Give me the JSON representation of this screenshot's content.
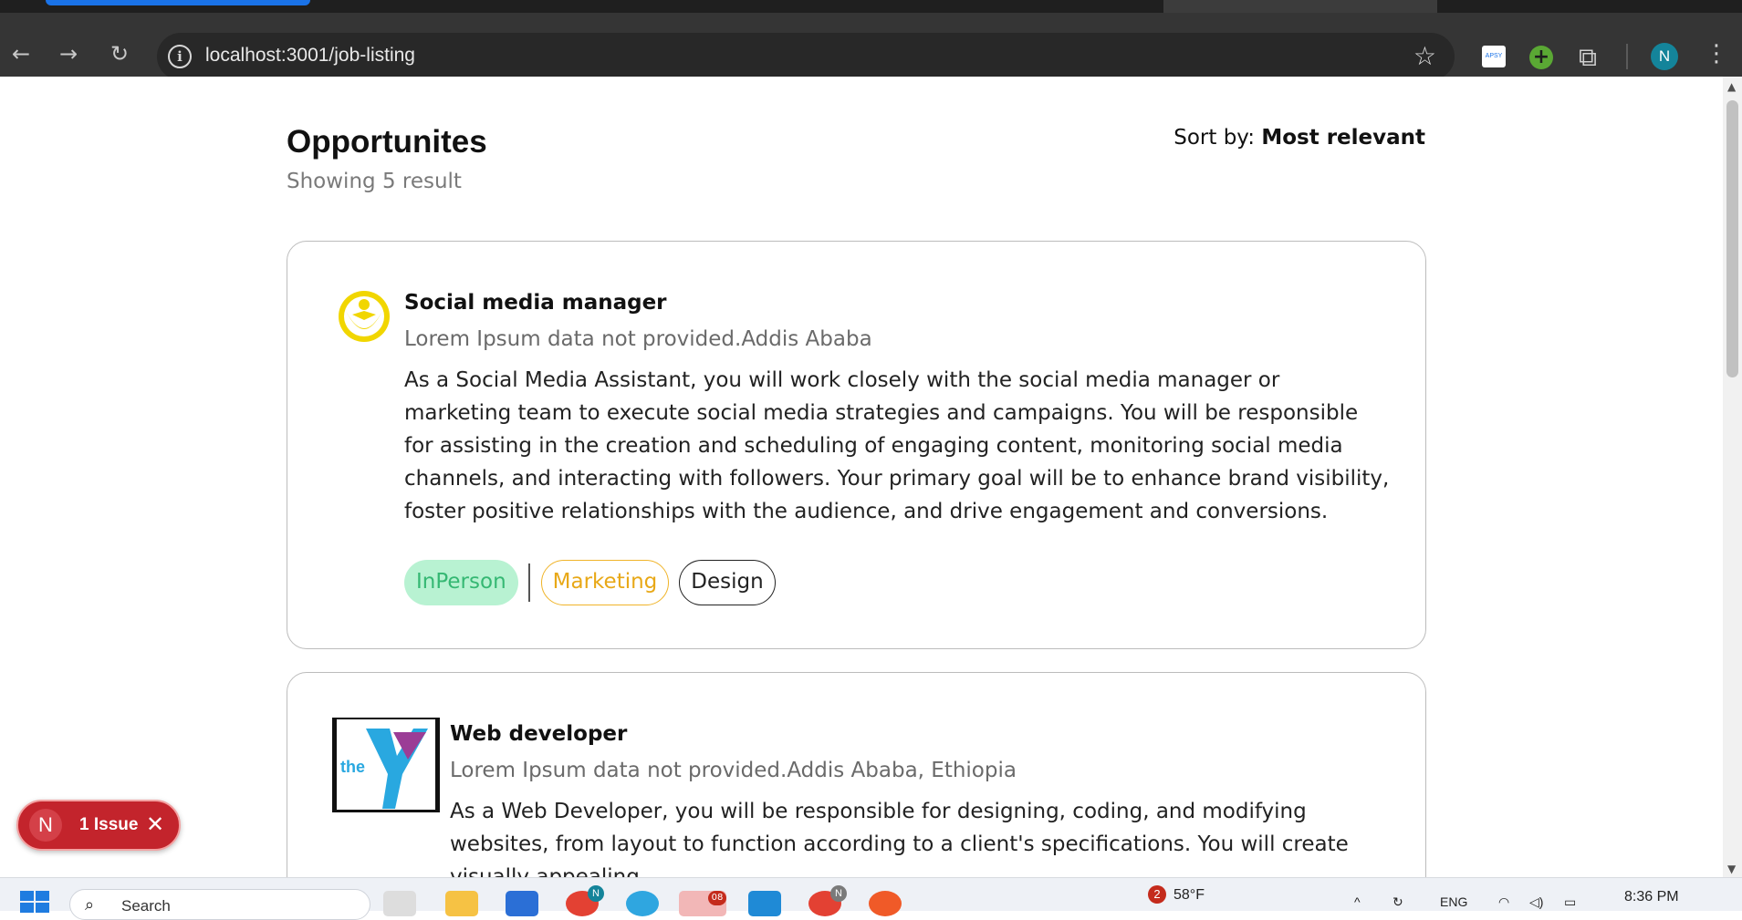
{
  "browser": {
    "url": "localhost:3001/job-listing"
  },
  "page": {
    "title": "Opportunites",
    "subtitle": "Showing 5 result",
    "sort_label": "Sort by:",
    "sort_value": "Most relevant"
  },
  "jobs": [
    {
      "title": "Social media manager",
      "company": "Lorem Ipsum data not provided.Addis Ababa",
      "description": "As a Social Media Assistant, you will work closely with the social media manager or marketing team to execute social media strategies and campaigns. You will be responsible for assisting in the creation and scheduling of engaging content, monitoring social media channels, and interacting with followers. Your primary goal will be to enhance brand visibility, foster positive relationships with the audience, and drive engagement and conversions.",
      "tags": [
        "InPerson",
        "Marketing",
        "Design"
      ],
      "logo_icon": "yellow-emblem-logo"
    },
    {
      "title": "Web developer",
      "company": "Lorem Ipsum data not provided.Addis Ababa, Ethiopia",
      "description": "As a Web Developer, you will be responsible for designing, coding, and modifying websites, from layout to function according to a client's specifications. You will create visually appealing",
      "logo_text": "the",
      "logo_icon": "ymca-logo"
    }
  ],
  "issue_badge": {
    "initial": "N",
    "label": "1 Issue"
  },
  "taskbar": {
    "search_placeholder": "Search",
    "weather_temp": "58°F",
    "weather_badge": "2",
    "lang": "ENG",
    "time": "8:36 PM",
    "chrome_badge": "N",
    "chrome2_badge": "N",
    "telegram_badge": "08"
  },
  "colors": {
    "accent_green_tag_bg": "#b8f2d2",
    "accent_green_tag_text": "#35b873",
    "marketing_tag": "#f0b429",
    "issue_red": "#c3242c"
  }
}
